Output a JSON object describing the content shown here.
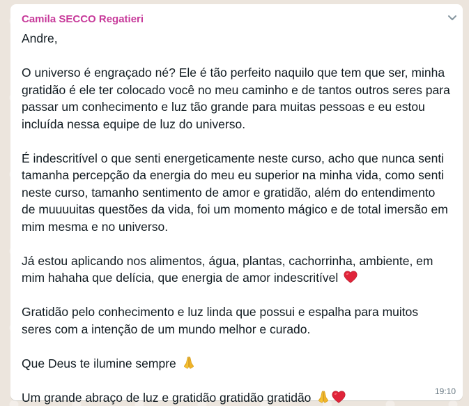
{
  "message": {
    "sender": "Camila SECCO Regatieri",
    "greeting": "Andre,",
    "p1": "O universo é engraçado né? Ele é tão perfeito naquilo que tem que ser, minha gratidão é ele ter colocado você no meu caminho e de tantos outros seres para passar um conhecimento e luz tão grande para muitas pessoas e eu estou incluída nessa equipe de luz do universo.",
    "p2": "É indescritível o que senti energeticamente neste curso, acho que nunca senti tamanha percepção da energia do meu eu superior na minha vida, como senti neste curso, tamanho sentimento de amor e gratidão, além do entendimento de muuuuitas questões da vida, foi um momento mágico e de total imersão em mim mesma e no universo.",
    "p3": "Já estou aplicando nos alimentos, água, plantas, cachorrinha, ambiente, em mim hahaha que delícia, que energia de amor indescritível",
    "p4": "Gratidão pelo conhecimento e luz linda que possui e espalha para muitos seres com a intenção de um mundo melhor e curado.",
    "p5": "Que Deus te ilumine sempre",
    "p6": "Um grande abraço de luz e gratidão gratidão gratidão",
    "time": "19:10"
  },
  "icons": {
    "menu": "chevron-down-icon",
    "heart": "red-heart-emoji",
    "pray": "folded-hands-emoji"
  },
  "colors": {
    "sender": "#c73a9a",
    "text": "#111b21",
    "time": "#667781",
    "bubble": "#ffffff",
    "background": "#ece5dd"
  }
}
